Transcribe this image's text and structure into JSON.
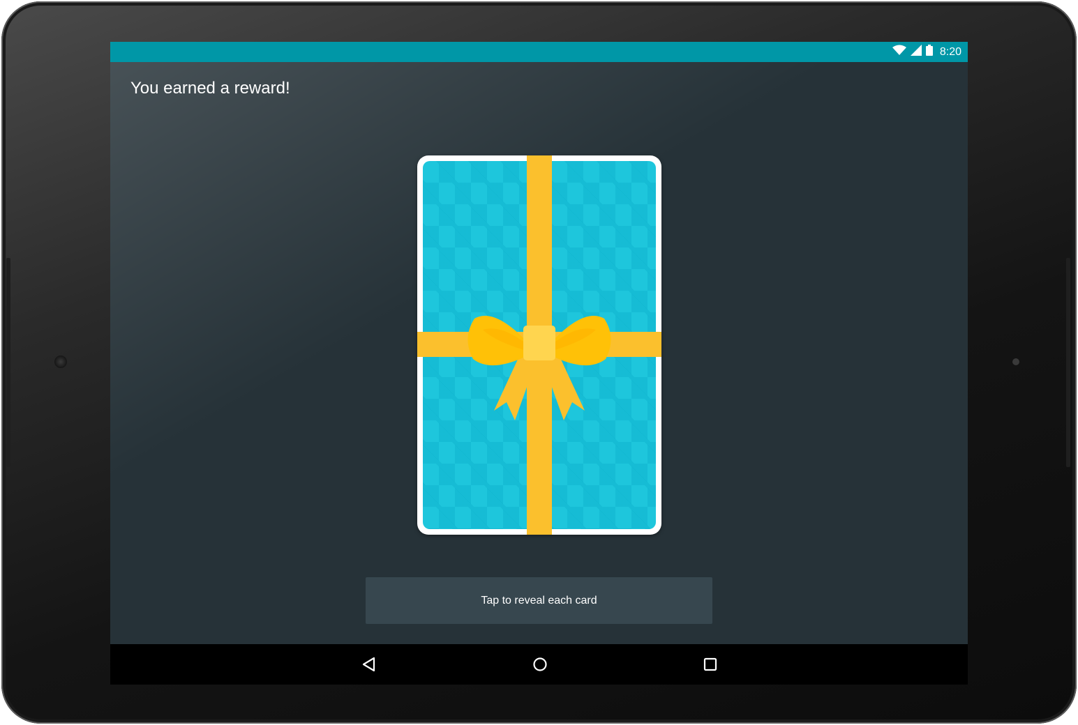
{
  "status_bar": {
    "time": "8:20",
    "icons": [
      "wifi-icon",
      "cell-signal-icon",
      "battery-icon"
    ],
    "background_color": "#0097a7"
  },
  "main": {
    "title": "You earned a reward!",
    "card": {
      "icon": "gift-card-bow-icon",
      "card_color": "#1ec6dc",
      "ribbon_color": "#fbc02d"
    },
    "reveal_button_label": "Tap to reveal each card"
  },
  "nav_bar": {
    "buttons": [
      "back-icon",
      "home-icon",
      "recents-icon"
    ]
  },
  "colors": {
    "screen_background": "#263238",
    "button_background": "#37474f"
  }
}
